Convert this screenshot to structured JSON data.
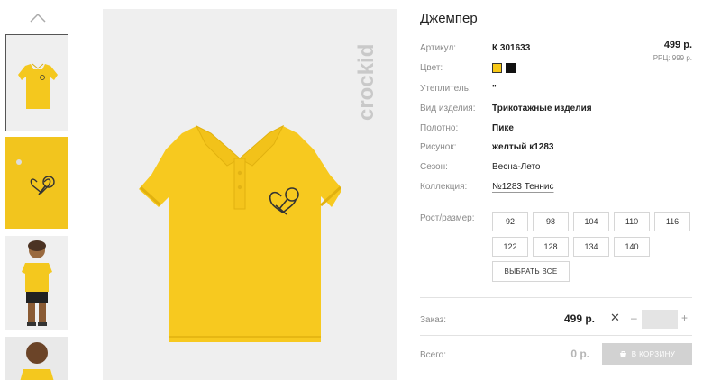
{
  "product": {
    "title": "Джемпер",
    "price": "499 р.",
    "rrp": "РРЦ: 999 р."
  },
  "brand": {
    "logo_text": "crockid"
  },
  "details": {
    "article_label": "Артикул:",
    "article_value": "К 301633",
    "color_label": "Цвет:",
    "colors": [
      {
        "name": "yellow",
        "hex": "#f7c817",
        "selected": true
      },
      {
        "name": "black",
        "hex": "#111111",
        "selected": false
      }
    ],
    "insulation_label": "Утеплитель:",
    "insulation_value": "\"",
    "type_label": "Вид изделия:",
    "type_value": "Трикотажные изделия",
    "fabric_label": "Полотно:",
    "fabric_value": "Пике",
    "pattern_label": "Рисунок:",
    "pattern_value": "желтый к1283",
    "season_label": "Сезон:",
    "season_value": "Весна-Лето",
    "collection_label": "Коллекция:",
    "collection_value": "№1283 Теннис"
  },
  "sizes": {
    "label": "Рост/размер:",
    "options": [
      "92",
      "98",
      "104",
      "110",
      "116",
      "122",
      "128",
      "134",
      "140"
    ],
    "select_all": "ВЫБРАТЬ ВСЕ"
  },
  "order": {
    "label": "Заказ:",
    "price": "499 р.",
    "remove": "✕",
    "minus": "–",
    "plus": "+",
    "quantity": ""
  },
  "total": {
    "label": "Всего:",
    "value": "0 р.",
    "cart_button": "В КОРЗИНУ"
  },
  "colors_ui": {
    "accent_yellow": "#f7c817",
    "disabled_button": "#d2d2d2"
  },
  "icons": [
    "chevron-up-icon",
    "cart-icon",
    "crockid-logo"
  ]
}
